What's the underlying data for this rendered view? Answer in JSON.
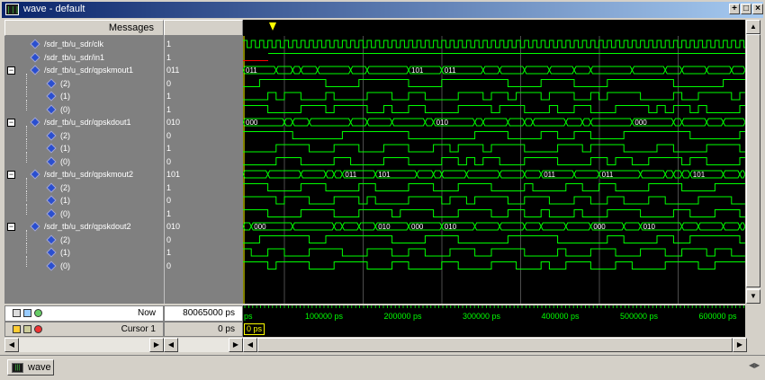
{
  "window": {
    "title": "wave - default",
    "icon_text": "|||"
  },
  "titlebar_buttons": [
    "+",
    "□",
    "×"
  ],
  "header": {
    "messages_label": "Messages"
  },
  "signals": [
    {
      "name": "/sdr_tb/u_sdr/clk",
      "value": "1",
      "level": 0,
      "expander": ""
    },
    {
      "name": "/sdr_tb/u_sdr/in1",
      "value": "1",
      "level": 0,
      "expander": ""
    },
    {
      "name": "/sdr_tb/u_sdr/qpskmout1",
      "value": "011",
      "level": 0,
      "expander": "−"
    },
    {
      "name": "(2)",
      "value": "0",
      "level": 1,
      "expander": ""
    },
    {
      "name": "(1)",
      "value": "1",
      "level": 1,
      "expander": ""
    },
    {
      "name": "(0)",
      "value": "1",
      "level": 1,
      "expander": ""
    },
    {
      "name": "/sdr_tb/u_sdr/qpskdout1",
      "value": "010",
      "level": 0,
      "expander": "−"
    },
    {
      "name": "(2)",
      "value": "0",
      "level": 1,
      "expander": ""
    },
    {
      "name": "(1)",
      "value": "1",
      "level": 1,
      "expander": ""
    },
    {
      "name": "(0)",
      "value": "0",
      "level": 1,
      "expander": ""
    },
    {
      "name": "/sdr_tb/u_sdr/qpskmout2",
      "value": "101",
      "level": 0,
      "expander": "−"
    },
    {
      "name": "(2)",
      "value": "1",
      "level": 1,
      "expander": ""
    },
    {
      "name": "(1)",
      "value": "0",
      "level": 1,
      "expander": ""
    },
    {
      "name": "(0)",
      "value": "1",
      "level": 1,
      "expander": ""
    },
    {
      "name": "/sdr_tb/u_sdr/qpskdout2",
      "value": "010",
      "level": 0,
      "expander": "−"
    },
    {
      "name": "(2)",
      "value": "0",
      "level": 1,
      "expander": ""
    },
    {
      "name": "(1)",
      "value": "1",
      "level": 1,
      "expander": ""
    },
    {
      "name": "(0)",
      "value": "0",
      "level": 1,
      "expander": ""
    }
  ],
  "bus_labels": {
    "qpskmout1": [
      "011",
      "101",
      "011",
      "101",
      "101",
      "101"
    ],
    "qpskdout1": [
      "000",
      "010",
      "000",
      "000",
      "010"
    ],
    "qpskmout2": [
      "011",
      "101",
      "011",
      "011",
      "101"
    ],
    "qpskdout2": [
      "000",
      "010",
      "000",
      "010"
    ]
  },
  "footer": {
    "now_label": "Now",
    "now_value": "80065000 ps",
    "cursor_label": "Cursor 1",
    "cursor_value": "0 ps",
    "cursor_time_box": "0 ps"
  },
  "timeline": {
    "tick_labels": [
      "ps",
      "100000 ps",
      "200000 ps",
      "300000 ps",
      "400000 ps",
      "500000 ps",
      "600000 ps"
    ]
  },
  "taskbar": {
    "tab_label": "wave"
  },
  "colors": {
    "wave": "#00ff00",
    "grid": "#808080",
    "cursor": "#ffff00",
    "bus_text": "#ffffff",
    "in1_low": "#ff0000"
  }
}
